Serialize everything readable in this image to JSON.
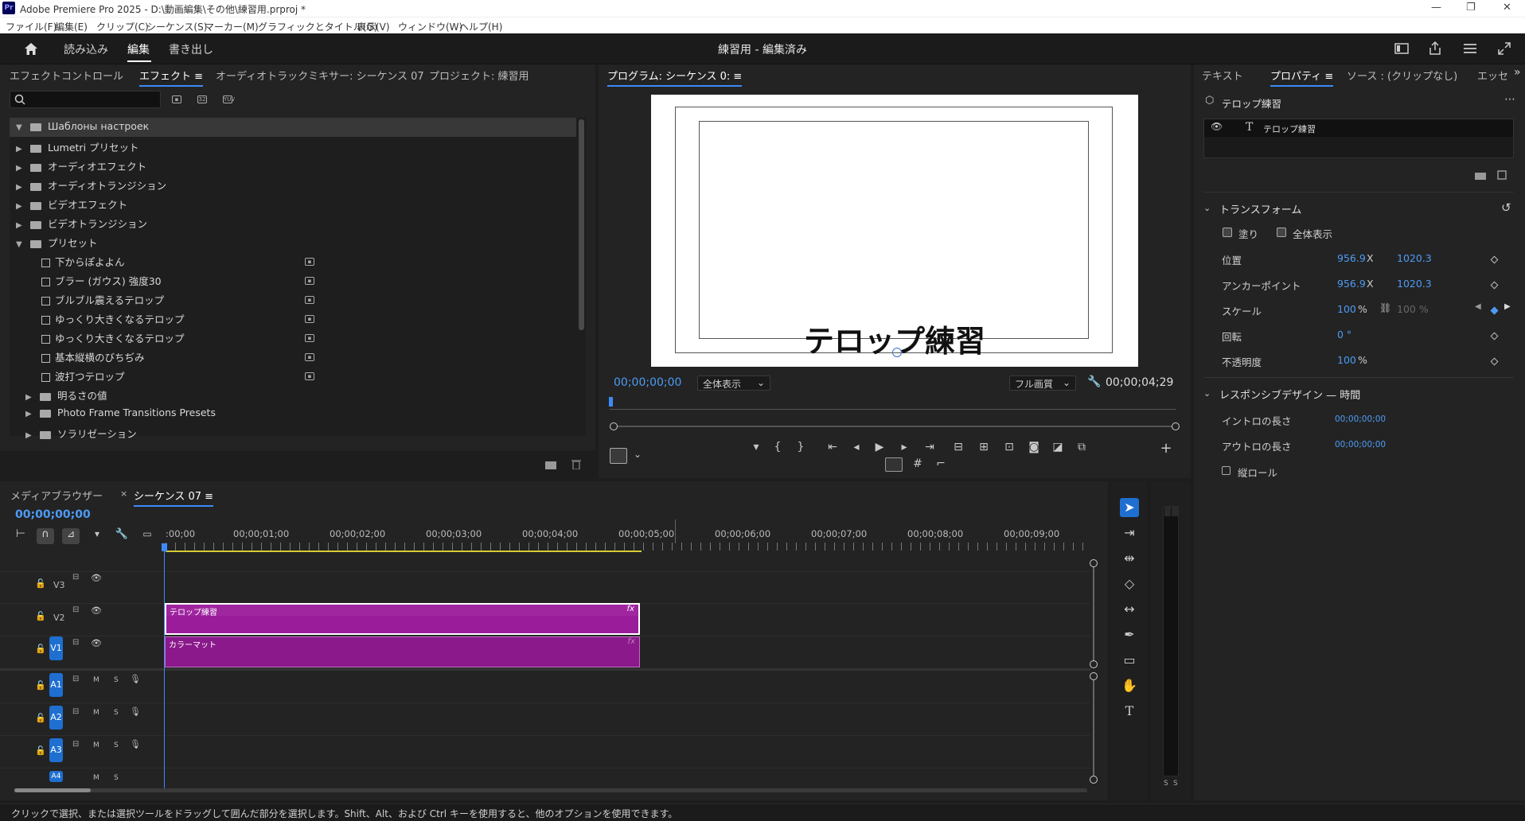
{
  "window": {
    "title": "Adobe Premiere Pro 2025 - D:\\動画編集\\その他\\練習用.prproj *",
    "app_icon": "Pr",
    "controls": [
      "—",
      "❐",
      "✕"
    ]
  },
  "menubar": [
    "ファイル(F)",
    "編集(E)",
    "クリップ(C)",
    "シーケンス(S)",
    "マーカー(M)",
    "グラフィックとタイトル(G)",
    "表示(V)",
    "ウィンドウ(W)",
    "ヘルプ(H)"
  ],
  "workspace": {
    "tabs": [
      "読み込み",
      "編集",
      "書き出し"
    ],
    "active_tab": "編集",
    "project_title": "練習用 - 編集済み"
  },
  "effects_panel": {
    "tabs": [
      "エフェクトコントロール",
      "エフェクト ≡",
      "オーディオトラックミキサー: シーケンス 07",
      "プロジェクト: 練習用"
    ],
    "active_tab": "エフェクト ≡",
    "tree": [
      {
        "label": "Шаблоны настроек",
        "type": "folder",
        "expanded": true,
        "depth": 0
      },
      {
        "label": "Lumetri プリセット",
        "type": "folder",
        "expanded": false,
        "depth": 0
      },
      {
        "label": "オーディオエフェクト",
        "type": "folder",
        "expanded": false,
        "depth": 0
      },
      {
        "label": "オーディオトランジション",
        "type": "folder",
        "expanded": false,
        "depth": 0
      },
      {
        "label": "ビデオエフェクト",
        "type": "folder",
        "expanded": false,
        "depth": 0
      },
      {
        "label": "ビデオトランジション",
        "type": "folder",
        "expanded": false,
        "depth": 0
      },
      {
        "label": "プリセット",
        "type": "folder",
        "expanded": true,
        "depth": 0
      },
      {
        "label": "下からぽよよん",
        "type": "preset",
        "depth": 1
      },
      {
        "label": "ブラー (ガウス) 強度30",
        "type": "preset",
        "depth": 1
      },
      {
        "label": "ブルブル震えるテロップ",
        "type": "preset",
        "depth": 1
      },
      {
        "label": "ゆっくり大きくなるテロップ",
        "type": "preset",
        "depth": 1
      },
      {
        "label": "ゆっくり大きくなるテロップ",
        "type": "preset",
        "depth": 1
      },
      {
        "label": "基本縦横のびちぢみ",
        "type": "preset",
        "depth": 1
      },
      {
        "label": "波打つテロップ",
        "type": "preset",
        "depth": 1
      },
      {
        "label": "明るさの値",
        "type": "folder",
        "expanded": false,
        "depth": 1
      },
      {
        "label": "Photo Frame Transitions Presets",
        "type": "folder",
        "expanded": false,
        "depth": 1
      },
      {
        "label": "ソラリゼーション",
        "type": "folder",
        "expanded": false,
        "depth": 1
      }
    ]
  },
  "program_monitor": {
    "tab": "プログラム: シーケンス 0: ≡",
    "caption": "テロップ練習",
    "timecode": "00;00;00;00",
    "zoom": "全体表示",
    "quality": "フル画質",
    "duration": "00;00;04;29"
  },
  "timeline": {
    "tabs": [
      "メディアブラウザー",
      "シーケンス 07 ≡"
    ],
    "close_mark": "×",
    "timecode": "00;00;00;00",
    "ruler": [
      ":00;00",
      "00;00;01;00",
      "00;00;02;00",
      "00;00;03;00",
      "00;00;04;00",
      "00;00;05;00",
      "00;00;06;00",
      "00;00;07;00",
      "00;00;08;00",
      "00;00;09;00"
    ],
    "video_tracks": [
      "V3",
      "V2",
      "V1"
    ],
    "audio_tracks": [
      "A1",
      "A2",
      "A3",
      "A4"
    ],
    "clip_v2": "テロップ練習",
    "clip_v1": "カラーマット",
    "fx": "fx",
    "mute": "M",
    "solo": "S",
    "meter_labels": [
      "S",
      "S"
    ]
  },
  "properties_panel": {
    "tabs": [
      "テキスト",
      "プロパティ ≡",
      "ソース : (クリップなし)",
      "エッセ"
    ],
    "active_tab": "プロパティ ≡",
    "layer_title": "テロップ練習",
    "layer_item": "テロップ練習",
    "transform_header": "トランスフォーム",
    "fill": "塗り",
    "show_all": "全体表示",
    "rows": [
      {
        "label": "位置",
        "v1": "956.9",
        "u1": "X",
        "v2": "1020.3"
      },
      {
        "label": "アンカーポイント",
        "v1": "956.9",
        "u1": "X",
        "v2": "1020.3"
      },
      {
        "label": "スケール",
        "v1": "100",
        "u1": "%",
        "v2": "100 %"
      },
      {
        "label": "回転",
        "v1": "0 °",
        "u1": "",
        "v2": ""
      },
      {
        "label": "不透明度",
        "v1": "100",
        "u1": "%",
        "v2": ""
      }
    ],
    "responsive_header": "レスポンシブデザイン — 時間",
    "intro_label": "イントロの長さ",
    "intro_value": "00;00;00;00",
    "outro_label": "アウトロの長さ",
    "outro_value": "00;00;00;00",
    "roll_label": "縦ロール"
  },
  "status": "クリックで選択、または選択ツールをドラッグして囲んだ部分を選択します。Shift、Alt、および Ctrl キーを使用すると、他のオプションを使用できます。"
}
